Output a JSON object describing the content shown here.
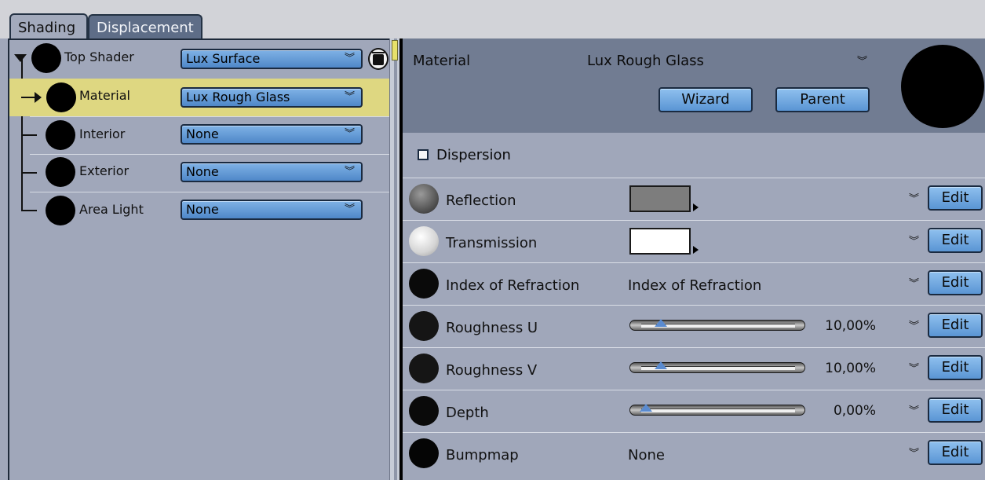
{
  "tabs": [
    {
      "label": "Shading",
      "active": true
    },
    {
      "label": "Displacement",
      "active": false
    }
  ],
  "tree": {
    "rows": [
      {
        "label": "Top Shader",
        "value": "Lux Surface"
      },
      {
        "label": "Material",
        "value": "Lux Rough Glass",
        "selected": true
      },
      {
        "label": "Interior",
        "value": "None"
      },
      {
        "label": "Exterior",
        "value": "None"
      },
      {
        "label": "Area Light",
        "value": "None"
      }
    ]
  },
  "material": {
    "label": "Material",
    "value": "Lux Rough Glass",
    "wizard_label": "Wizard",
    "parent_label": "Parent"
  },
  "dispersion": {
    "label": "Dispersion",
    "checked": false
  },
  "properties": [
    {
      "label": "Reflection",
      "type": "color",
      "color": "#7d7d7d",
      "ball": "gray"
    },
    {
      "label": "Transmission",
      "type": "color",
      "color": "#ffffff",
      "ball": "white"
    },
    {
      "label": "Index of Refraction",
      "type": "text",
      "value": "Index of Refraction"
    },
    {
      "label": "Roughness U",
      "type": "slider",
      "value": "10,00%",
      "fraction": 0.1
    },
    {
      "label": "Roughness V",
      "type": "slider",
      "value": "10,00%",
      "fraction": 0.1
    },
    {
      "label": "Depth",
      "type": "slider",
      "value": "0,00%",
      "fraction": 0.0
    },
    {
      "label": "Bumpmap",
      "type": "text",
      "value": "None"
    }
  ],
  "edit_label": "Edit",
  "colors": {
    "accent": "#5a95d4",
    "selected_row": "#ded781",
    "panel": "#a0a7ba"
  },
  "icons": {
    "trash": "trash-icon",
    "dropdown": "double-chevron-down-icon"
  }
}
